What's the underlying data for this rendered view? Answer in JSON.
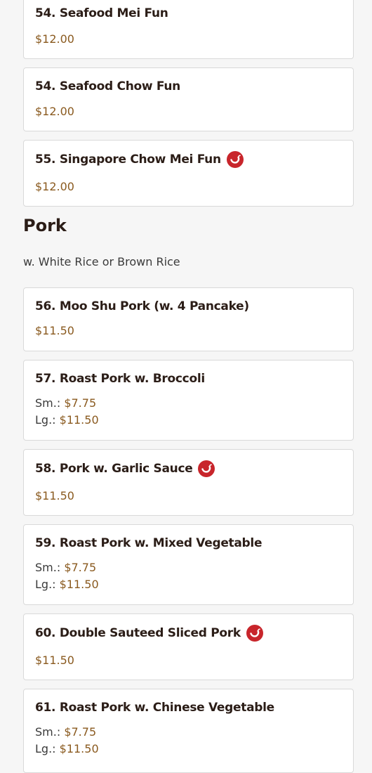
{
  "items_top": [
    {
      "name": "54. Seafood Mei Fun",
      "price": "$12.00"
    },
    {
      "name": "54. Seafood Chow Fun",
      "price": "$12.00"
    },
    {
      "name": "55. Singapore Chow Mei Fun",
      "price": "$12.00",
      "spicy_icon": "chili-pepper-icon"
    }
  ],
  "section": {
    "title": "Pork",
    "note": "w. White Rice or Brown Rice"
  },
  "items_pork": [
    {
      "name": "56. Moo Shu Pork (w. 4 Pancake)",
      "price": "$11.50"
    },
    {
      "name": "57. Roast Pork w. Broccoli",
      "small_label": "Sm.:",
      "small_price": "$7.75",
      "large_label": "Lg.:",
      "large_price": "$11.50"
    },
    {
      "name": "58. Pork w. Garlic Sauce",
      "price": "$11.50",
      "spicy_icon": "chili-pepper-icon"
    },
    {
      "name": "59. Roast Pork w. Mixed Vegetable",
      "small_label": "Sm.:",
      "small_price": "$7.75",
      "large_label": "Lg.:",
      "large_price": "$11.50"
    },
    {
      "name": "60. Double Sauteed Sliced Pork",
      "price": "$11.50",
      "spicy_icon": "chili-pepper-icon"
    },
    {
      "name": "61. Roast Pork w. Chinese Vegetable",
      "small_label": "Sm.:",
      "small_price": "$7.75",
      "large_label": "Lg.:",
      "large_price": "$11.50"
    }
  ],
  "colors": {
    "price": "#8a5a1f",
    "spicy_badge": "#c8252b",
    "card_border": "#d9d9d9",
    "page_bg": "#f6f6f6"
  }
}
